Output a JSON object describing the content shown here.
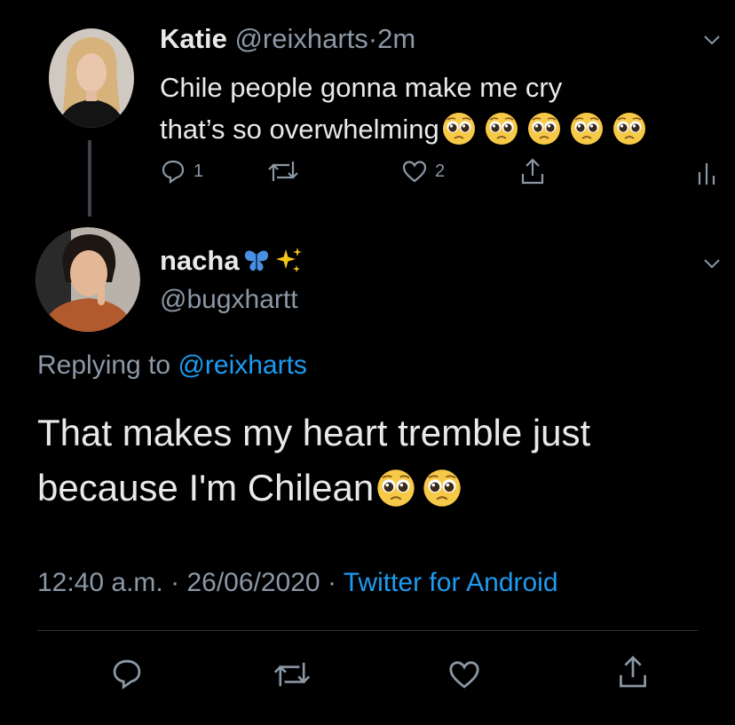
{
  "tweet1": {
    "display_name": "Katie",
    "handle": "@reixharts",
    "separator": "·",
    "time": "2m",
    "text_line1": "Chile people gonna make me cry",
    "text_line2": "that’s so overwhelming",
    "emoji_count": 5,
    "reply_count": "1",
    "like_count": "2"
  },
  "tweet2": {
    "display_name": "nacha",
    "handle": "@bugxhartt",
    "replying_prefix": "Replying to",
    "replying_to": "@reixharts",
    "text_line1": "That makes my heart tremble just",
    "text_line2": "because I'm Chilean",
    "emoji_count": 2,
    "time": "12:40 a.m.",
    "date": "26/06/2020",
    "source": "Twitter for Android",
    "separator": "·"
  },
  "colors": {
    "background": "#000000",
    "text": "#e7e9ea",
    "muted": "#8b98a5",
    "link": "#1d9bf0",
    "butterfly": "#4a90e2",
    "sparkles": "#f5c518"
  },
  "icons": [
    "reply-icon",
    "retweet-icon",
    "like-icon",
    "share-icon",
    "analytics-icon",
    "chevron-down-icon",
    "pleading-face-emoji",
    "butterfly-emoji",
    "sparkles-emoji"
  ]
}
